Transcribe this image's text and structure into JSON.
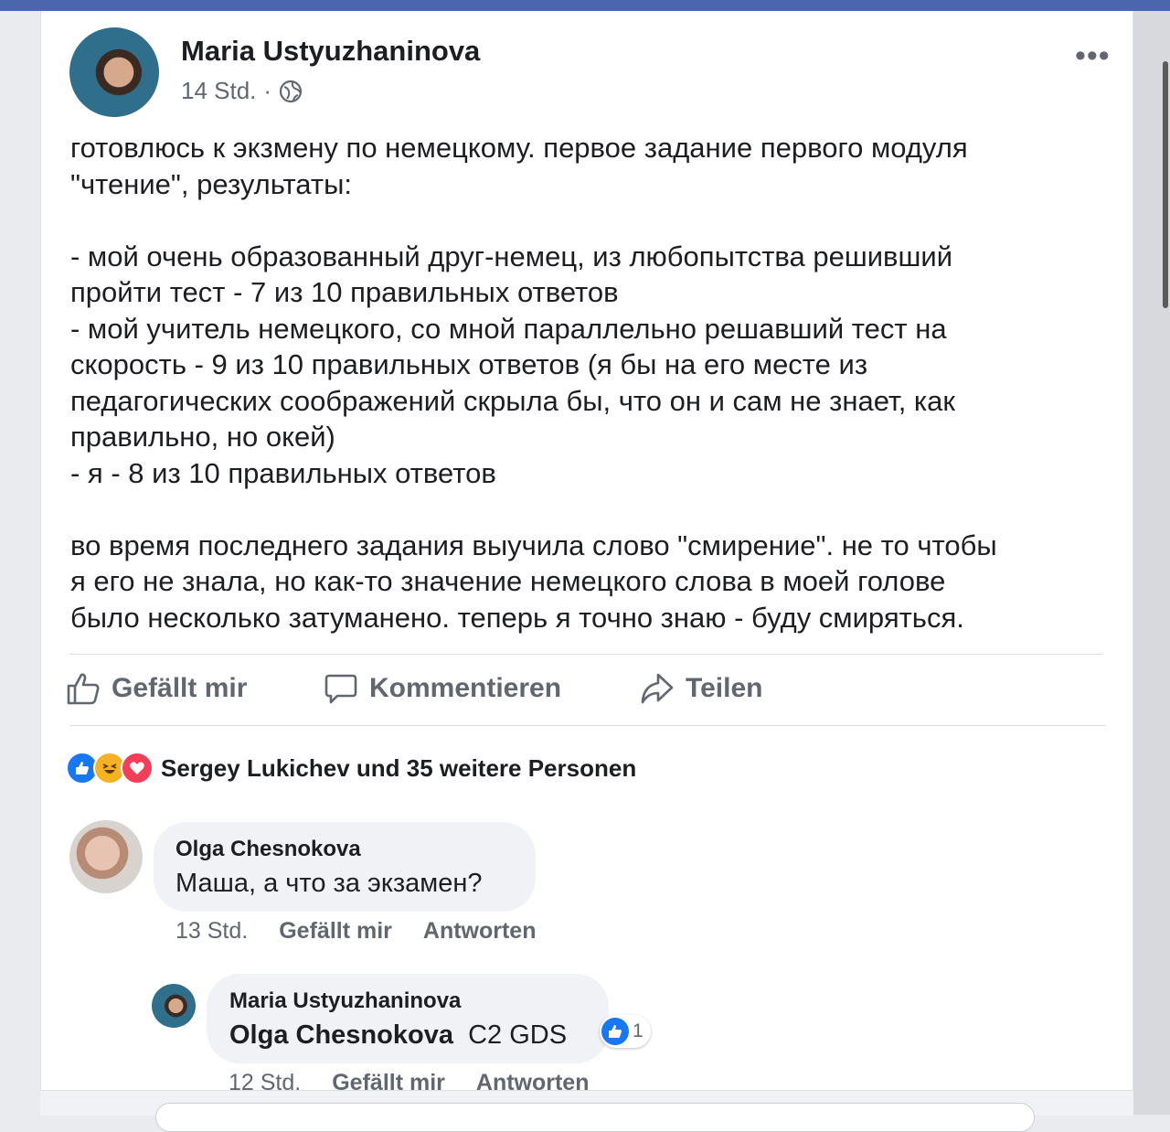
{
  "post": {
    "author": "Maria Ustyuzhaninova",
    "time": "14 Std.",
    "visibility_icon": "globe-icon",
    "menu_icon": "more-horizontal-icon",
    "text_lines": [
      "готовлюсь к экзмену по немецкому. первое задание первого модуля",
      "\"чтение\", результаты:",
      "",
      "- мой очень образованный друг-немец, из любопытства решивший",
      "пройти тест - 7 из 10 правильных ответов",
      "- мой учитель немецкого, со мной параллельно решавший тест на",
      "скорость - 9 из 10 правильных ответов (я бы на его месте из",
      "педагогических соображений скрыла бы, что он и сам не знает, как",
      "правильно, но окей)",
      "- я - 8 из 10 правильных ответов",
      "",
      "во время последнего задания выучила слово \"смирение\". не то чтобы",
      "я его не знала, но как-то значение немецкого слова в моей голове",
      "было несколько затуманено. теперь я точно знаю - буду смиряться."
    ]
  },
  "actions": {
    "like": "Gefällt mir",
    "comment": "Kommentieren",
    "share": "Teilen"
  },
  "reactions": {
    "summary": "Sergey Lukichev und 35 weitere Personen",
    "icons": [
      "like-icon",
      "haha-icon",
      "love-icon"
    ],
    "colors": {
      "like": "#1877f2",
      "haha": "#f7b125",
      "love": "#f33e58"
    }
  },
  "comments": [
    {
      "author": "Olga Chesnokova",
      "text": "Маша, а что за экзамен?",
      "time": "13 Std.",
      "like_label": "Gefällt mir",
      "reply_label": "Antworten"
    },
    {
      "author": "Maria Ustyuzhaninova",
      "mention": "Olga Chesnokova",
      "text": "C2 GDS",
      "like_count": "1",
      "time": "12 Std.",
      "like_label": "Gefällt mir",
      "reply_label": "Antworten"
    }
  ]
}
